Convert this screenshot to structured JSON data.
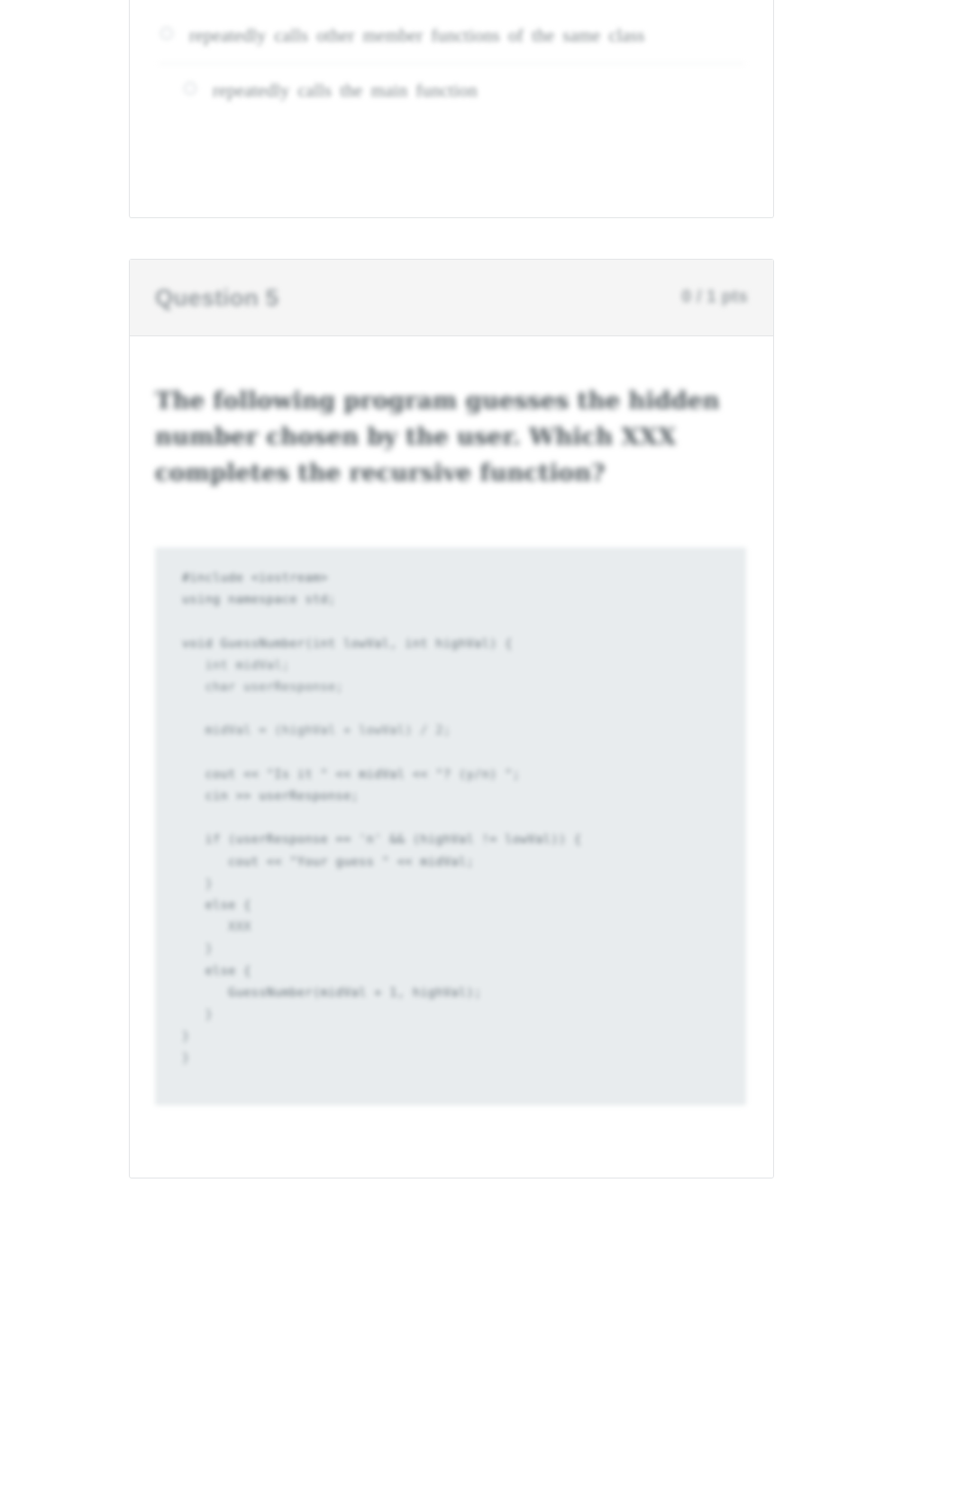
{
  "previous_question": {
    "answers": [
      {
        "id": "answer-member-functions",
        "text": "repeatedly calls other member functions of the same class",
        "selected": false
      },
      {
        "id": "answer-main-function",
        "text": "repeatedly calls the main function",
        "selected": false
      }
    ]
  },
  "question": {
    "title": "Question 5",
    "points": "0 / 1 pts",
    "prompt": "The following program guesses the hidden number chosen by the user. Which XXX completes the recursive function?",
    "ellipsis": "",
    "code": [
      "#include <iostream>",
      "using namespace std;",
      "",
      "void GuessNumber(int lowVal, int highVal) {",
      "   int midVal;",
      "   char userResponse;",
      "",
      "   midVal = (highVal + lowVal) / 2;",
      "",
      "   cout << \"Is it \" << midVal << \"? (y/n) \";",
      "   cin >> userResponse;",
      "",
      "   if (userResponse == 'n' && (highVal != lowVal)) {",
      "      cout << \"Your guess \" << midVal;",
      "   }",
      "   else {",
      "      XXX",
      "   }",
      "   else {",
      "      GuessNumber(midVal + 1, highVal);",
      "   }",
      "}",
      "}"
    ]
  },
  "colors": {
    "page_background": "#ffffff",
    "card_background": "#ffffff",
    "card_border": "#e3e5e7",
    "header_background": "#f5f5f5",
    "code_background": "#e8ecee",
    "muted_text": "#9aa0a4",
    "body_text": "#4e575c",
    "code_text": "#7b868c"
  }
}
